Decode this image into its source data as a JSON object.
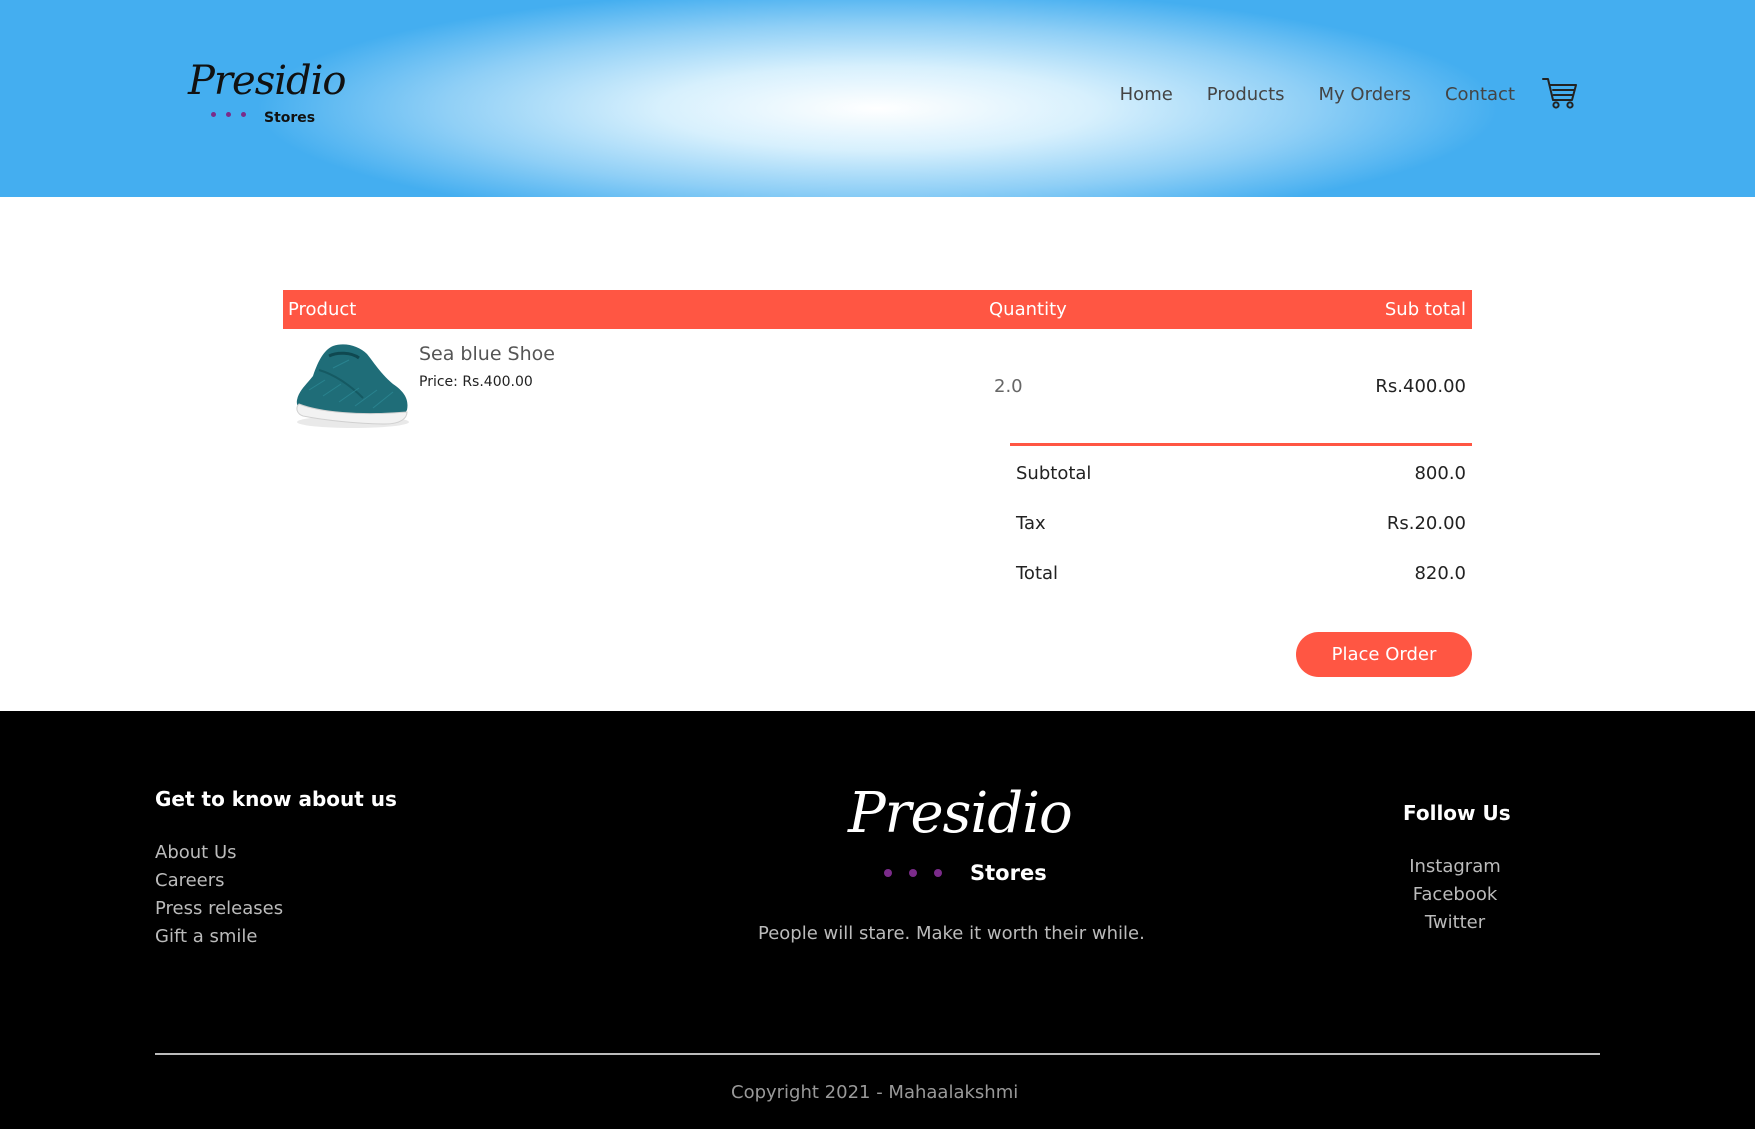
{
  "header": {
    "logo_script": "Presidio",
    "logo_sub": "Stores",
    "nav": [
      "Home",
      "Products",
      "My Orders",
      "Contact"
    ],
    "cart_icon": "cart-icon"
  },
  "cart": {
    "columns": {
      "product": "Product",
      "quantity": "Quantity",
      "subtotal": "Sub total"
    },
    "items": [
      {
        "name": "Sea blue Shoe",
        "price": "Price: Rs.400.00",
        "quantity": "2.0",
        "subtotal": "Rs.400.00",
        "image_icon": "shoe-image",
        "shoe_color": "#1f6d78"
      }
    ],
    "summary": {
      "subtotal_label": "Subtotal",
      "subtotal_value": "800.0",
      "tax_label": "Tax",
      "tax_value": "Rs.20.00",
      "total_label": "Total",
      "total_value": "820.0"
    },
    "place_order_label": "Place Order"
  },
  "footer": {
    "about_heading": "Get to know about us",
    "about_links": [
      "About Us",
      "Careers",
      "Press releases",
      "Gift a smile"
    ],
    "logo_script": "Presidio",
    "logo_sub": "Stores",
    "tagline": "People will stare. Make it worth their while.",
    "follow_heading": "Follow Us",
    "social_links": [
      "Instagram",
      "Facebook",
      "Twitter"
    ],
    "copyright": "Copyright 2021 - Mahaalakshmi"
  },
  "colors": {
    "accent": "#ff5643",
    "logo_dots": "#7b2b8a",
    "header_sky": "#44aef0",
    "footer_bg": "#000000"
  }
}
